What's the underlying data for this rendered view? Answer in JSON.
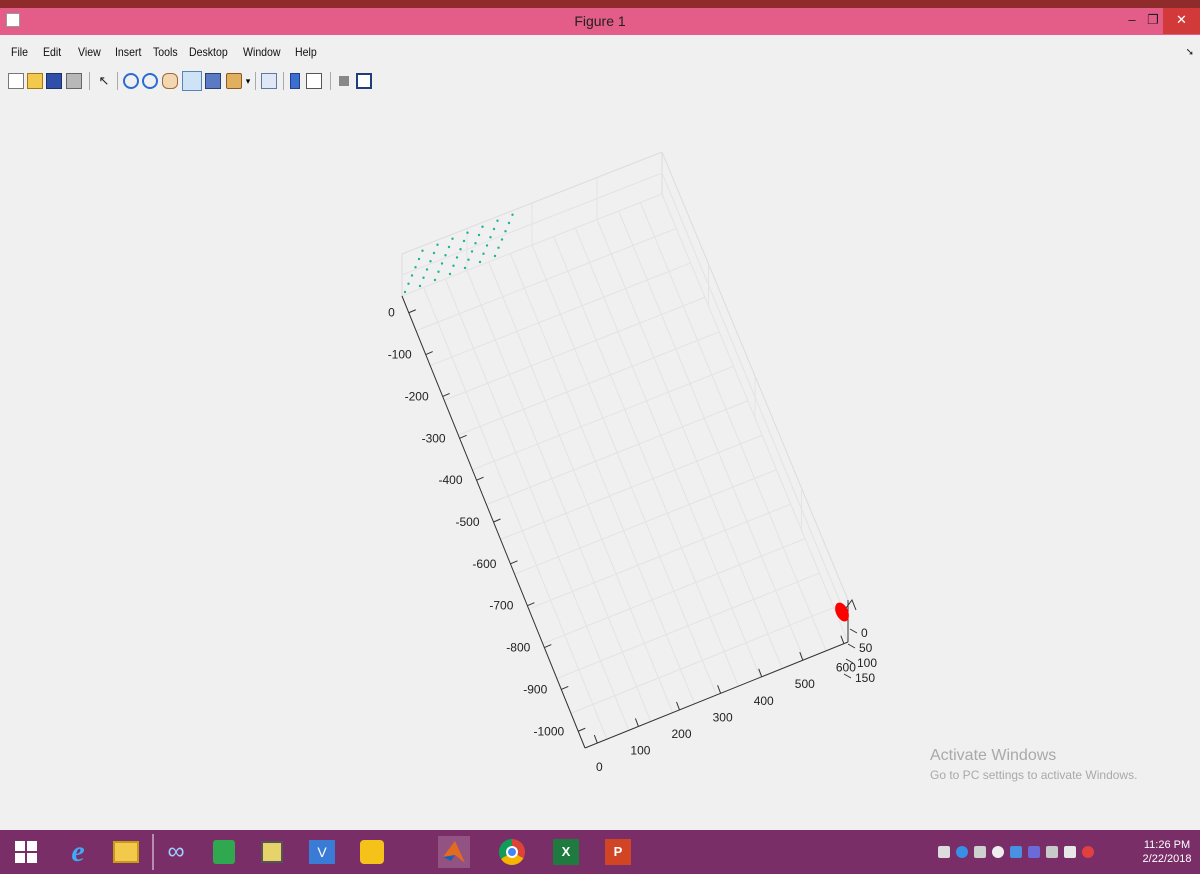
{
  "window": {
    "title": "Figure 1"
  },
  "menu": [
    {
      "label": "File"
    },
    {
      "label": "Edit"
    },
    {
      "label": "View"
    },
    {
      "label": "Insert"
    },
    {
      "label": "Tools"
    },
    {
      "label": "Desktop"
    },
    {
      "label": "Window"
    },
    {
      "label": "Help"
    }
  ],
  "toolbar_icons": [
    "new-figure",
    "open-file",
    "save",
    "print",
    "select-arrow",
    "zoom-in",
    "zoom-out",
    "pan",
    "rotate-3d",
    "data-cursor",
    "brush",
    "link-plot",
    "colorbar",
    "legend",
    "hide-plot-tools",
    "show-plot-tools"
  ],
  "axes": {
    "y_ticks": [
      "0",
      "-100",
      "-200",
      "-300",
      "-400",
      "-500",
      "-600",
      "-700",
      "-800",
      "-900",
      "-1000"
    ],
    "x_ticks": [
      "0",
      "100",
      "200",
      "300",
      "400",
      "500",
      "600"
    ],
    "z_ticks": [
      "0",
      "50",
      "100",
      "150"
    ],
    "grid": true,
    "point_cloud_color": "#1fb39a",
    "marker_color": "#ff0000"
  },
  "watermark": {
    "title": "Activate Windows",
    "subtitle": "Go to PC settings to activate Windows."
  },
  "taskbar": {
    "apps": [
      "start",
      "internet-explorer",
      "file-explorer",
      "infinity-app",
      "store",
      "network-app",
      "vc-app",
      "puzzle-app",
      "matlab",
      "chrome",
      "excel",
      "powerpoint"
    ],
    "tray_icons": [
      "tray-1",
      "tray-2",
      "tray-3",
      "tray-4",
      "tray-5",
      "tray-6",
      "tray-7",
      "tray-8",
      "tray-9"
    ],
    "clock_time": "11:26 PM",
    "clock_date": "2/22/2018"
  }
}
